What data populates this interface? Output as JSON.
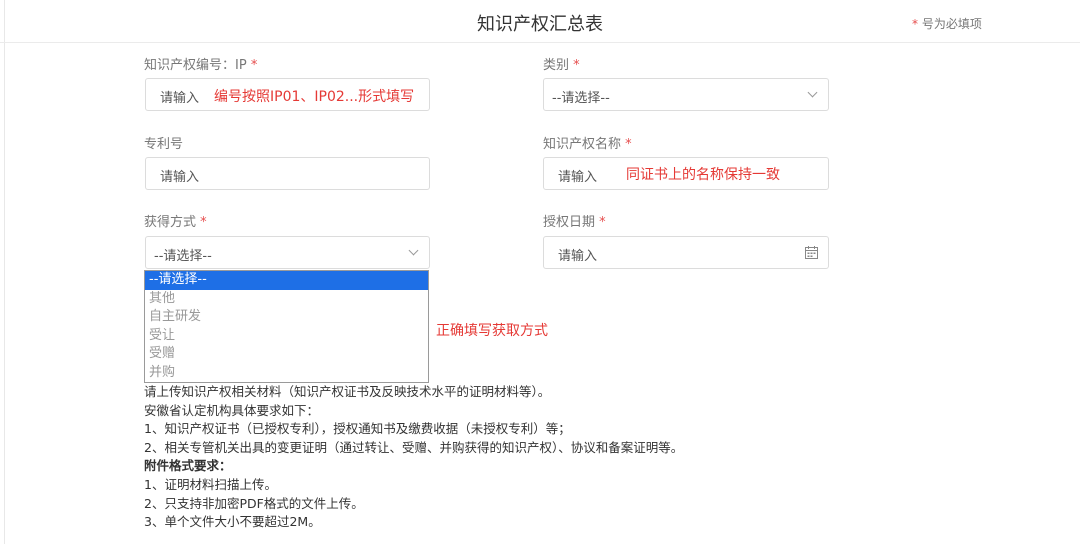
{
  "page": {
    "title": "知识产权汇总表",
    "required_note_star": "*",
    "required_note_text": " 号为必填项"
  },
  "form": {
    "ip_number": {
      "label": "知识产权编号：IP",
      "star": "*",
      "placeholder": "请输入",
      "annotation": "编号按照IP01、IP02...形式填写"
    },
    "category": {
      "label": "类别",
      "star": "*",
      "value": "--请选择--"
    },
    "patent_number": {
      "label": "专利号",
      "placeholder": "请输入"
    },
    "ip_name": {
      "label": "知识产权名称",
      "star": "*",
      "placeholder": "请输入",
      "annotation": "同证书上的名称保持一致"
    },
    "acquisition": {
      "label": "获得方式",
      "star": "*",
      "value": "--请选择--",
      "options": [
        "--请选择--",
        "其他",
        "自主研发",
        "受让",
        "受赠",
        "并购"
      ],
      "annotation": "正确填写获取方式"
    },
    "grant_date": {
      "label": "授权日期",
      "star": "*",
      "placeholder": "请输入"
    }
  },
  "upload_notes": {
    "lines": [
      "请上传知识产权相关材料（知识产权证书及反映技术水平的证明材料等）。",
      "安徽省认定机构具体要求如下：",
      "1、知识产权证书（已授权专利），授权通知书及缴费收据（未授权专利）等；",
      "2、相关专管机关出具的变更证明（通过转让、受赠、并购获得的知识产权）、协议和备案证明等。"
    ],
    "format_heading": "附件格式要求：",
    "format_lines": [
      "1、证明材料扫描上传。",
      "2、只支持非加密PDF格式的文件上传。",
      "3、单个文件大小不要超过2M。"
    ]
  },
  "colors": {
    "required": "#e64c4c",
    "annotation": "#e53935",
    "selected_option": "#1e6fe6"
  },
  "icons": {
    "dropdown": "chevron-down-icon",
    "date": "calendar-icon"
  }
}
